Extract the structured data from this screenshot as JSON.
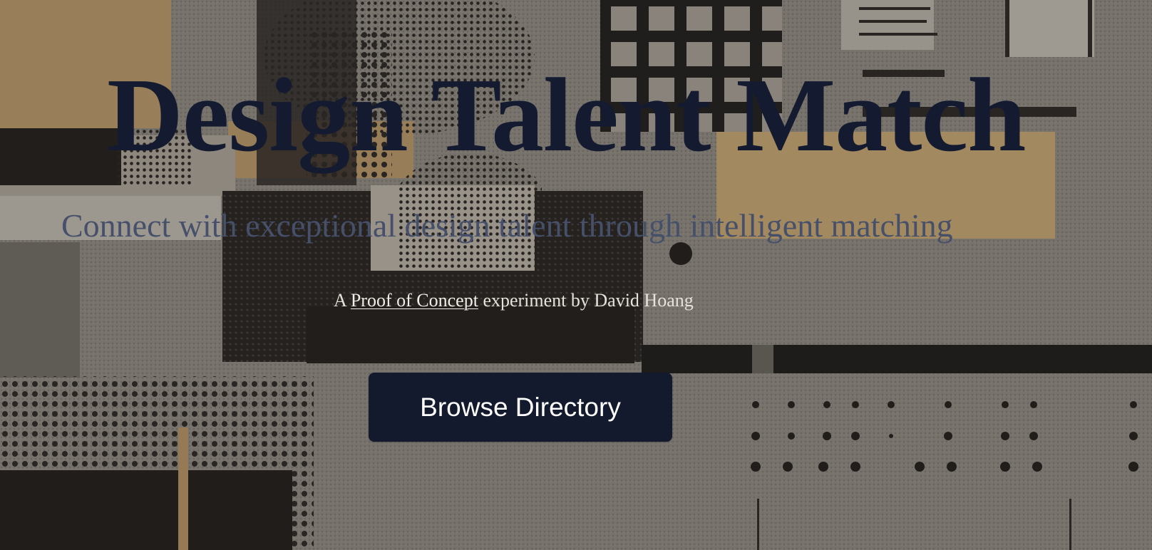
{
  "hero": {
    "title": "Design Talent Match",
    "subtitle": "Connect with exceptional design talent through intelligent matching",
    "credit": {
      "prefix": "A",
      "link_text": "Proof of Concept",
      "suffix": "experiment by David Hoang"
    },
    "cta_label": "Browse Directory"
  },
  "colors": {
    "title": "#141b30",
    "subtitle": "#46506a",
    "button_bg": "#131a2d",
    "button_text": "#ffffff",
    "background_accent": "#d9b57a"
  }
}
